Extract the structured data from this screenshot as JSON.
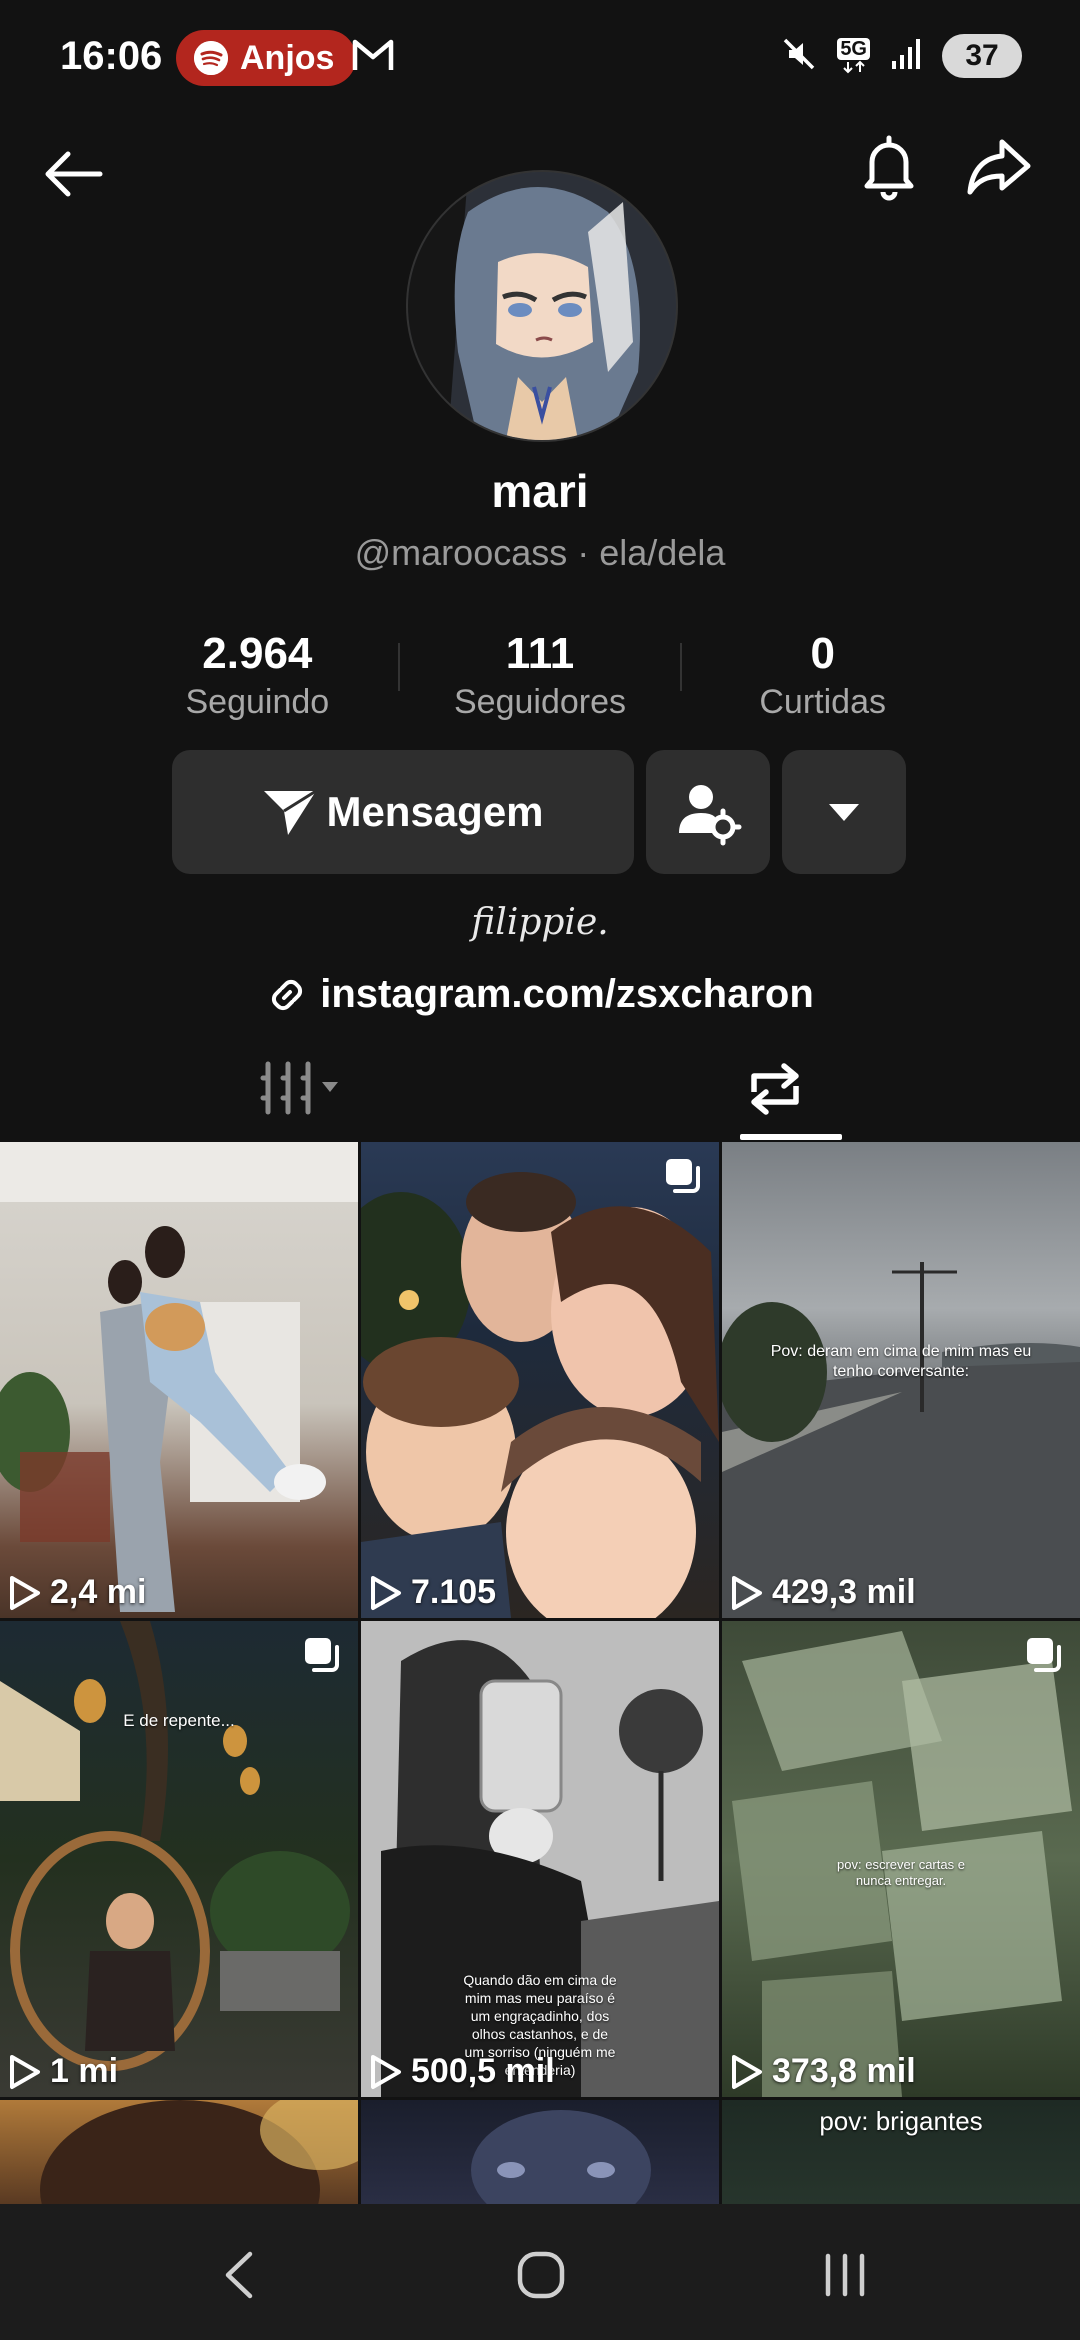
{
  "status_bar": {
    "time": "16:06",
    "spotify_label": "Anjos",
    "network": "5G",
    "battery": "37"
  },
  "profile": {
    "name": "mari",
    "handle": "@maroocass",
    "pronouns": "ela/dela",
    "separator": "·",
    "stats": [
      {
        "value": "2.964",
        "label": "Seguindo"
      },
      {
        "value": "111",
        "label": "Seguidores"
      },
      {
        "value": "0",
        "label": "Curtidas"
      }
    ],
    "message_button": "Mensagem",
    "bio": "filippie.",
    "link": "instagram.com/zsxcharon"
  },
  "grid": [
    {
      "views": "2,4 mi",
      "multi": false,
      "caption": ""
    },
    {
      "views": "7.105",
      "multi": true,
      "caption": ""
    },
    {
      "views": "429,3 mil",
      "multi": false,
      "caption": "Pov: deram em cima de mim mas eu tenho conversante:"
    },
    {
      "views": "1 mi",
      "multi": true,
      "caption": "E de repente..."
    },
    {
      "views": "500,5 mil",
      "multi": false,
      "caption": "Quando dão em cima de mim mas meu paraíso é um engraçadinho, dos olhos castanhos, e de um sorriso (ninguém me entenderia)"
    },
    {
      "views": "373,8 mil",
      "multi": true,
      "caption": "pov: escrever cartas e nunca entregar."
    },
    {
      "views": "",
      "multi": false,
      "caption": ""
    },
    {
      "views": "",
      "multi": false,
      "caption": ""
    },
    {
      "views": "",
      "multi": false,
      "caption": "pov: brigantes"
    }
  ],
  "colors": {
    "background": "#121212",
    "button": "#2e2e2e",
    "spotify_pill": "#b3261e",
    "secondary_text": "#9a9a9a"
  }
}
